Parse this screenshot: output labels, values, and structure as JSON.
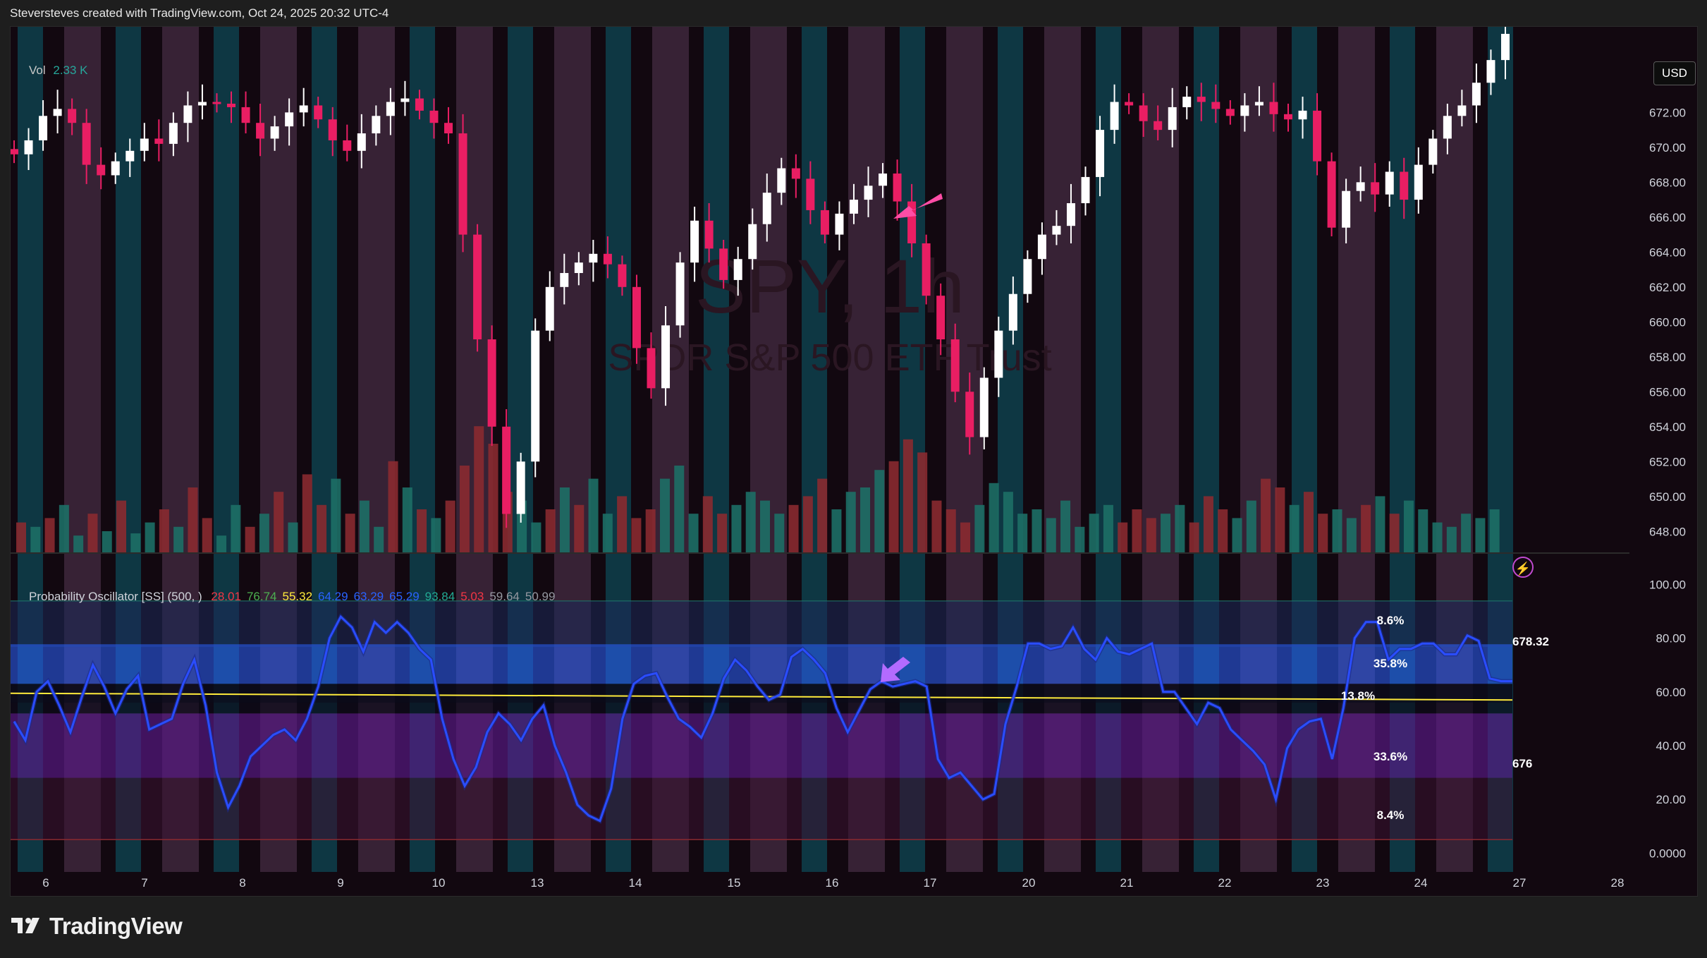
{
  "header": {
    "credit": "Steversteves created with TradingView.com, Oct 24, 2025 20:32 UTC-4"
  },
  "watermark": {
    "symbol": "SPY, 1h",
    "name": "SPDR S&P 500 ETF Trust"
  },
  "currency_button": "USD",
  "volume_legend": {
    "label": "Vol",
    "value": "2.33 K"
  },
  "oscillator_legend": {
    "title": "Probability Oscillator [SS] (500, )",
    "values": [
      {
        "text": "28.01",
        "color": "#f23645"
      },
      {
        "text": "76.74",
        "color": "#4caf50"
      },
      {
        "text": "55.32",
        "color": "#ffeb3b"
      },
      {
        "text": "64.29",
        "color": "#2962ff"
      },
      {
        "text": "63.29",
        "color": "#2962ff"
      },
      {
        "text": "65.29",
        "color": "#2962ff"
      },
      {
        "text": "93.84",
        "color": "#22ab94"
      },
      {
        "text": "5.03",
        "color": "#f23645"
      },
      {
        "text": "59.64",
        "color": "#9598a1"
      },
      {
        "text": "50.99",
        "color": "#9598a1"
      }
    ]
  },
  "oscillator_annotations": [
    "8.6%",
    "35.8%",
    "13.8%",
    "33.6%",
    "8.4%",
    "678.32",
    "676"
  ],
  "brand": "TradingView",
  "icons": {
    "lightning": "lightning-icon",
    "logo": "tradingview-logo",
    "arrow": "arrow-annotation"
  },
  "colors": {
    "up": "#ffffff",
    "down": "#e91e63",
    "vol_up": "#26a69a",
    "vol_down": "#ef5350",
    "osc_line": "#2a4dff",
    "median": "#ffeb3b",
    "band_blue": "#2962ff",
    "band_purple": "#6a1b9a"
  },
  "chart_data": [
    {
      "type": "candlestick",
      "title": "SPY, 1h",
      "subtitle": "SPDR S&P 500 ETF Trust",
      "ylim": [
        647,
        676.5
      ],
      "y_ticks": [
        "672.00",
        "670.00",
        "668.00",
        "666.00",
        "664.00",
        "662.00",
        "660.00",
        "658.00",
        "656.00",
        "654.00",
        "652.00",
        "650.00",
        "648.00"
      ],
      "x_ticks": [
        "6",
        "7",
        "8",
        "9",
        "10",
        "13",
        "14",
        "15",
        "16",
        "17",
        "20",
        "21",
        "22",
        "23",
        "24",
        "27",
        "28"
      ],
      "close_path": [
        669.6,
        670.4,
        671.8,
        672.2,
        671.4,
        669.0,
        668.4,
        669.2,
        669.8,
        670.5,
        670.2,
        671.4,
        672.4,
        672.6,
        672.5,
        672.3,
        671.4,
        670.5,
        671.2,
        672.0,
        672.4,
        671.6,
        670.4,
        669.8,
        670.8,
        671.8,
        672.6,
        672.8,
        672.1,
        671.4,
        670.8,
        665.0,
        659.0,
        654.0,
        649.0,
        652.0,
        659.5,
        662.0,
        662.8,
        663.4,
        663.9,
        663.3,
        662.0,
        658.5,
        656.2,
        659.8,
        663.4,
        665.8,
        664.2,
        662.4,
        663.6,
        665.6,
        667.4,
        668.8,
        668.2,
        666.4,
        665.0,
        666.2,
        667.0,
        667.8,
        668.5,
        666.9,
        664.5,
        661.5,
        659.0,
        656.0,
        653.4,
        656.8,
        659.5,
        661.6,
        663.6,
        665.0,
        665.5,
        666.8,
        668.3,
        671.0,
        672.6,
        672.4,
        671.5,
        671.0,
        672.3,
        672.9,
        672.6,
        672.2,
        671.8,
        672.4,
        672.6,
        671.9,
        671.6,
        672.1,
        669.2,
        665.4,
        667.5,
        668.0,
        667.3,
        668.6,
        667.0,
        669.0,
        670.5,
        671.8,
        672.4,
        673.7,
        675.0,
        676.5
      ],
      "volume_note": "volume bars beneath price (K)",
      "volume_ylim": [
        0,
        60
      ],
      "volume_values": [
        14,
        12,
        16,
        22,
        8,
        18,
        10,
        24,
        9,
        14,
        20,
        12,
        30,
        16,
        8,
        22,
        12,
        18,
        28,
        14,
        36,
        22,
        34,
        18,
        24,
        12,
        42,
        30,
        20,
        16,
        24,
        40,
        58,
        50,
        28,
        24,
        14,
        20,
        30,
        22,
        34,
        18,
        26,
        16,
        20,
        34,
        40,
        18,
        26,
        18,
        22,
        28,
        24,
        18,
        22,
        26,
        34,
        20,
        28,
        30,
        38,
        42,
        52,
        46,
        24,
        20,
        14,
        22,
        32,
        28,
        18,
        20,
        16,
        24,
        12,
        18,
        22,
        14,
        20,
        16,
        18,
        22,
        14,
        26,
        20,
        16,
        24,
        34,
        30,
        22,
        28,
        18,
        20,
        16,
        22,
        26,
        18,
        24,
        20,
        14,
        12,
        18,
        16,
        20
      ],
      "volume_up": [
        0,
        1,
        0,
        1,
        1,
        0,
        1,
        0,
        1,
        1,
        0,
        1,
        0,
        0,
        1,
        1,
        0,
        1,
        0,
        1,
        0,
        0,
        1,
        0,
        1,
        1,
        0,
        1,
        0,
        1,
        0,
        0,
        0,
        0,
        0,
        1,
        1,
        0,
        1,
        0,
        1,
        1,
        0,
        0,
        0,
        1,
        1,
        1,
        0,
        0,
        1,
        1,
        1,
        1,
        0,
        0,
        0,
        1,
        1,
        1,
        1,
        0,
        0,
        0,
        0,
        0,
        0,
        1,
        1,
        1,
        1,
        1,
        1,
        1,
        1,
        1,
        1,
        0,
        0,
        0,
        1,
        1,
        0,
        0,
        0,
        1,
        1,
        0,
        0,
        1,
        0,
        0,
        1,
        1,
        0,
        1,
        0,
        1,
        1,
        1,
        1,
        1,
        1,
        1
      ]
    },
    {
      "type": "line",
      "title": "Probability Oscillator [SS]",
      "ylim": [
        -7,
        108
      ],
      "y_ticks": [
        "100.00",
        "80.00",
        "60.00",
        "40.00",
        "20.00",
        "0.0000"
      ],
      "bands": {
        "upper_top": 93.84,
        "upper_inner": 76.74,
        "median": 59.64,
        "lower_inner": 50.99,
        "lower_outer": 28.01,
        "lower_bottom": 5.03
      },
      "series": [
        {
          "values": [
            49,
            42,
            60,
            64,
            55,
            45,
            58,
            70,
            62,
            52,
            61,
            66,
            46,
            48,
            50,
            63,
            72,
            55,
            30,
            17,
            25,
            36,
            40,
            44,
            46,
            42,
            50,
            62,
            80,
            88,
            84,
            75,
            86,
            82,
            86,
            82,
            76,
            72,
            50,
            35,
            25,
            32,
            45,
            52,
            48,
            42,
            50,
            55,
            40,
            30,
            18,
            14,
            12,
            24,
            50,
            63,
            66,
            67,
            58,
            50,
            47,
            43,
            52,
            65,
            72,
            68,
            62,
            57,
            59,
            73,
            76,
            72,
            67,
            54,
            45,
            53,
            61,
            64,
            62,
            63,
            64,
            62,
            35,
            28,
            30,
            25,
            20,
            22,
            48,
            62,
            78,
            78,
            76,
            77,
            84,
            76,
            72,
            80,
            75,
            74,
            76,
            78,
            60,
            60,
            54,
            48,
            56,
            54,
            46,
            42,
            38,
            33,
            20,
            39,
            46,
            49,
            50,
            35,
            54,
            80,
            86,
            86,
            72,
            76,
            76,
            78,
            78,
            74,
            74,
            81,
            79,
            65,
            64,
            64
          ]
        }
      ]
    }
  ]
}
